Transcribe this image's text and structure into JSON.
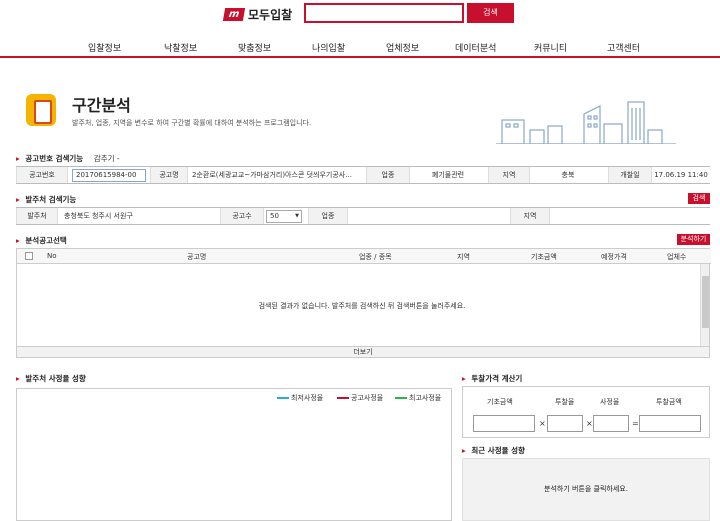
{
  "header": {
    "logo_mark": "m",
    "logo_text": "모두입찰",
    "search_value": "",
    "search_button": "검색"
  },
  "nav": [
    "입찰정보",
    "낙찰정보",
    "맞춤정보",
    "나의입찰",
    "업체정보",
    "데이터분석",
    "커뮤니티",
    "고객센터"
  ],
  "page": {
    "title": "구간분석",
    "description": "발주처, 업종, 지역을 변수로 하여 구간별 확률에 대하여 분석하는 프로그램입니다."
  },
  "notice_search": {
    "title": "공고번호 검색기능",
    "fold": "감추기 -",
    "no_label": "공고번호",
    "no_value": "20170615984-00",
    "name_label": "공고명",
    "name_value": "2순환로(세광교교~가마삼거리)아스콘 덧씌우기공사...",
    "type_label": "업종",
    "type_value": "폐기물관련",
    "region_label": "지역",
    "region_value": "충북",
    "date_label": "개찰일",
    "date_value": "17.06.19 11:40"
  },
  "orderer_search": {
    "title": "발주처 검색기능",
    "button": "검색",
    "orderer_label": "발주처",
    "orderer_value": "충청북도 청주시 서원구",
    "count_label": "공고수",
    "count_value": "50",
    "type_label": "업종",
    "region_label": "지역"
  },
  "analysis": {
    "title": "분석공고선택",
    "button": "분석하기",
    "columns": [
      "No",
      "공고명",
      "업종 / 종목",
      "지역",
      "기초금액",
      "예정가격",
      "업체수"
    ],
    "empty_message": "검색된 결과가 없습니다. 발주처를 검색하신 뒤 검색버튼을 눌러주세요.",
    "more": "더보기"
  },
  "orderer_rate": {
    "title": "발주처 사정율 성향",
    "legend": [
      {
        "label": "최저사정율",
        "color": "#29a9e0"
      },
      {
        "label": "공고사정율",
        "color": "#c8102e"
      },
      {
        "label": "최고사정율",
        "color": "#2db34a"
      }
    ]
  },
  "calculator": {
    "title": "투찰가격 계산기",
    "labels": [
      "기초금액",
      "투찰율",
      "사정율",
      "투찰금액"
    ],
    "ops": [
      "×",
      "×",
      "="
    ]
  },
  "recent": {
    "title": "최근 사정율 성향",
    "message": "분석하기 버튼을 클릭하세요."
  },
  "colors": {
    "accent": "#c8102e"
  }
}
